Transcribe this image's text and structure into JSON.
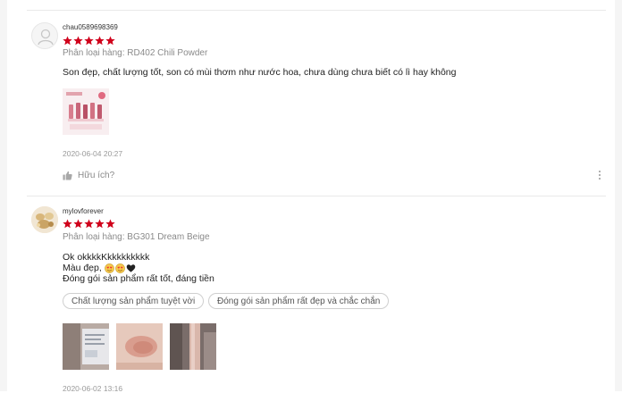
{
  "colors": {
    "star": "#d0011b",
    "divider": "#e9e9e9",
    "muted": "#8a8a8a"
  },
  "reviews": [
    {
      "username": "chau0589698369",
      "rating": 5,
      "variation": "Phân loại hàng: RD402 Chili Powder",
      "comment_lines": [
        "Son đẹp, chất lượng tốt, son có mùi thơm như nước hoa, chưa dùng chưa biết có lì hay không"
      ],
      "timestamp": "2020-06-04 20:27",
      "helpful_label": "Hữu ích?",
      "avatar_icon": "default-user-icon"
    },
    {
      "username": "mylovforever",
      "rating": 5,
      "variation": "Phân loại hàng: BG301 Dream Beige",
      "comment_lines": [
        "Ok okkkkKkkkkkkkkk",
        "Màu đẹp,",
        "Đóng gói sản phẩm rất tốt, đáng tiền"
      ],
      "tags": [
        "Chất lượng sản phẩm tuyệt vời",
        "Đóng gói sản phẩm rất đẹp và chắc chắn"
      ],
      "timestamp": "2020-06-02 13:16",
      "emojis": [
        "heart-eyes-emoji",
        "heart-eyes-emoji",
        "black-heart-emoji"
      ]
    }
  ]
}
